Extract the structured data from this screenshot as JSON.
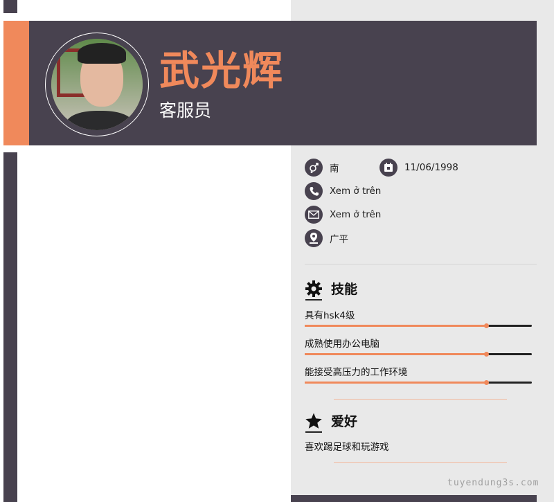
{
  "header": {
    "name": "武光辉",
    "job_title": "客服员"
  },
  "contact": {
    "gender": "南",
    "birthday": "11/06/1998",
    "phone": "Xem ở trên",
    "email": "Xem ở trên",
    "address": "广平"
  },
  "skills": {
    "title": "技能",
    "items": [
      {
        "label": "具有hsk4级",
        "level": 0.8
      },
      {
        "label": "成熟使用办公电脑",
        "level": 0.8
      },
      {
        "label": "能接受高压力的工作环境",
        "level": 0.8
      }
    ]
  },
  "hobbies": {
    "title": "爱好",
    "text": "喜欢踢足球和玩游戏"
  },
  "watermark": "tuyendung3s.com",
  "colors": {
    "accent": "#f0895b",
    "dark": "#48424f",
    "panel": "#e9e9e9"
  },
  "icons": [
    "gender-icon",
    "calendar-icon",
    "phone-icon",
    "email-icon",
    "location-icon",
    "gear-icon",
    "star-icon"
  ]
}
